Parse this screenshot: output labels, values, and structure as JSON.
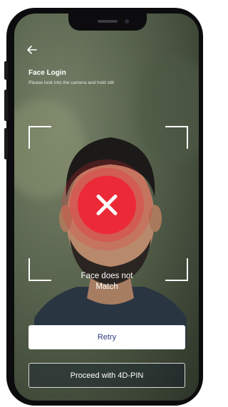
{
  "header": {
    "title": "Face Login",
    "subtitle": "Please look into the camera and hold still"
  },
  "result": {
    "status_text": "Face does not\nMatch",
    "status_color": "#ec2a37",
    "icon": "close-icon"
  },
  "actions": {
    "retry_label": "Retry",
    "pin_label": "Proceed with 4D-PIN"
  },
  "icons": {
    "back": "arrow-left-icon",
    "status": "close-icon"
  },
  "colors": {
    "accent": "#ec2a37",
    "retry_text": "#2d3a7a"
  }
}
